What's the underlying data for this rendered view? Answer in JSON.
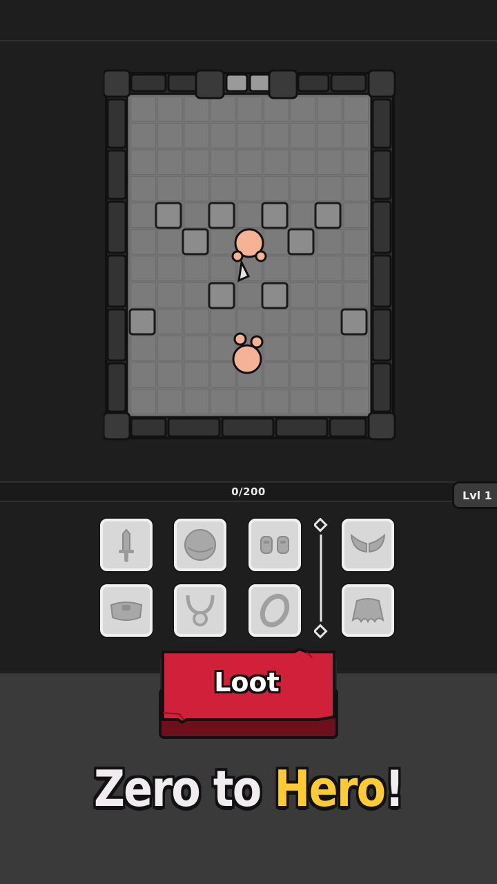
{
  "xp": {
    "text": "0/200",
    "current": 0,
    "max": 200
  },
  "level": {
    "label": "Lvl 1"
  },
  "equipment_slots": [
    {
      "icon": "sword-icon",
      "state": "empty"
    },
    {
      "icon": "helmet-icon",
      "state": "empty"
    },
    {
      "icon": "gloves-icon",
      "state": "empty"
    },
    {
      "icon": "wings-icon",
      "state": "empty"
    },
    {
      "icon": "armor-icon",
      "state": "empty"
    },
    {
      "icon": "necklace-icon",
      "state": "empty"
    },
    {
      "icon": "ring-icon",
      "state": "empty"
    },
    {
      "icon": "cape-icon",
      "state": "empty"
    }
  ],
  "loot_button": {
    "label": "Loot",
    "color": "#d0203a"
  },
  "tagline": {
    "part1": "Zero to ",
    "part2": "Hero",
    "part3": "!"
  },
  "colors": {
    "accent_yellow": "#ffcb2e",
    "button_red": "#d0203a"
  }
}
